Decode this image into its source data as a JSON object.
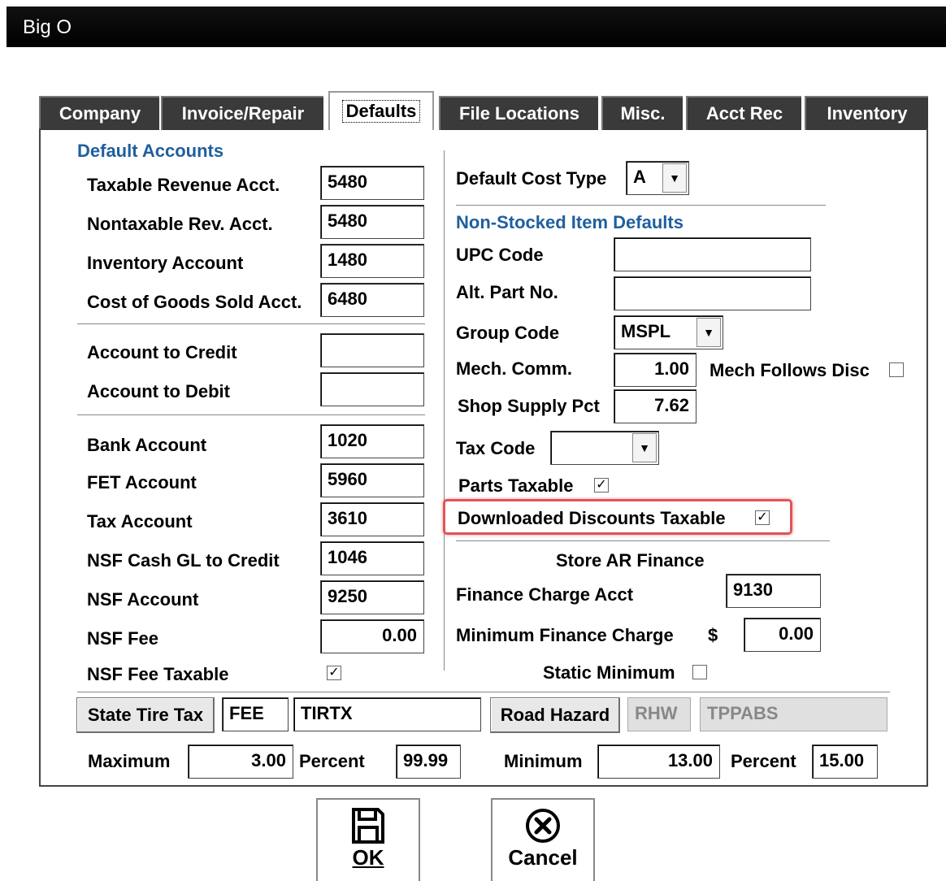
{
  "window": {
    "title": "Big O"
  },
  "tabs": [
    {
      "label": "Company"
    },
    {
      "label": "Invoice/Repair"
    },
    {
      "label": "Defaults"
    },
    {
      "label": "File Locations"
    },
    {
      "label": "Misc."
    },
    {
      "label": "Acct Rec"
    },
    {
      "label": "Inventory"
    }
  ],
  "default_accounts": {
    "heading": "Default Accounts",
    "taxable_revenue": {
      "label": "Taxable Revenue Acct.",
      "value": "5480"
    },
    "nontaxable_revenue": {
      "label": "Nontaxable Rev. Acct.",
      "value": "5480"
    },
    "inventory": {
      "label": "Inventory Account",
      "value": "1480"
    },
    "cogs": {
      "label": "Cost of Goods Sold Acct.",
      "value": "6480"
    },
    "account_to_credit": {
      "label": "Account to Credit",
      "value": ""
    },
    "account_to_debit": {
      "label": "Account to Debit",
      "value": ""
    },
    "bank": {
      "label": "Bank Account",
      "value": "1020"
    },
    "fet": {
      "label": "FET Account",
      "value": "5960"
    },
    "tax": {
      "label": "Tax Account",
      "value": "3610"
    },
    "nsf_cash_gl": {
      "label": "NSF Cash GL to Credit",
      "value": "1046"
    },
    "nsf_account": {
      "label": "NSF Account",
      "value": "9250"
    },
    "nsf_fee": {
      "label": "NSF Fee",
      "value": "0.00"
    },
    "nsf_fee_taxable": {
      "label": "NSF Fee Taxable",
      "checked": true
    }
  },
  "right": {
    "default_cost_type": {
      "label": "Default Cost Type",
      "value": "A"
    },
    "non_stocked_heading": "Non-Stocked Item Defaults",
    "upc_code": {
      "label": "UPC Code",
      "value": ""
    },
    "alt_part_no": {
      "label": "Alt. Part No.",
      "value": ""
    },
    "group_code": {
      "label": "Group Code",
      "value": "MSPL"
    },
    "mech_comm": {
      "label": "Mech. Comm.",
      "value": "1.00"
    },
    "mech_follows_disc": {
      "label": "Mech Follows Disc",
      "checked": false
    },
    "shop_supply_pct": {
      "label": "Shop Supply Pct",
      "value": "7.62"
    },
    "tax_code": {
      "label": "Tax Code",
      "value": ""
    },
    "parts_taxable": {
      "label": "Parts Taxable",
      "checked": true
    },
    "downloaded_discounts_taxable": {
      "label": "Downloaded Discounts Taxable",
      "checked": true
    },
    "store_ar_heading": "Store AR Finance",
    "finance_charge_acct": {
      "label": "Finance Charge Acct",
      "value": "9130"
    },
    "minimum_finance_charge": {
      "label": "Minimum Finance Charge",
      "currency": "$",
      "value": "0.00"
    },
    "static_minimum": {
      "label": "Static Minimum",
      "checked": false
    }
  },
  "tire_tax": {
    "state_tire_tax_button": "State Tire Tax",
    "code1": "FEE",
    "code2": "TIRTX",
    "road_hazard_button": "Road Hazard",
    "rh_code1": "RHW",
    "rh_code2": "TPPABS",
    "maximum_label": "Maximum",
    "maximum_value": "3.00",
    "percent_label": "Percent",
    "percent_value": "99.99",
    "minimum_label": "Minimum",
    "minimum_value": "13.00",
    "percent2_label": "Percent",
    "percent2_value": "15.00"
  },
  "buttons": {
    "ok_label": "OK",
    "cancel_label": "Cancel"
  },
  "check_glyph": "✓"
}
